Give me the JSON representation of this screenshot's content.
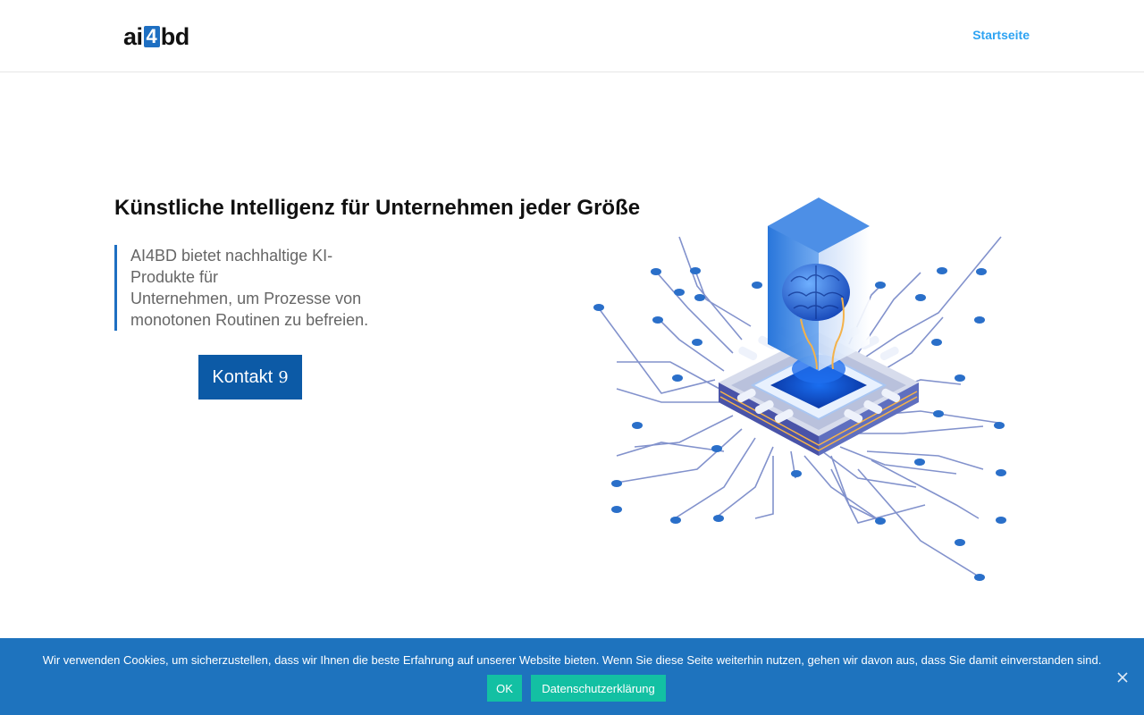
{
  "header": {
    "logo": {
      "part1": "ai",
      "part2": "4",
      "part3": "bd"
    },
    "nav": [
      {
        "label": "Startseite"
      }
    ]
  },
  "hero": {
    "title": "Künstliche Intelligenz für Unternehmen jeder Größe",
    "text_lines": [
      "AI4BD bietet nachhaltige KI-",
      "Produkte für",
      "Unternehmen, um Prozesse von",
      "monotonen Routinen zu befreien."
    ],
    "button": {
      "label": "Kontakt",
      "icon": "chat-icon",
      "icon_glyph": "9"
    }
  },
  "illustration": {
    "icon": "ai-chip-brain-illustration"
  },
  "cookie_bar": {
    "text": "Wir verwenden Cookies, um sicherzustellen, dass wir Ihnen die beste Erfahrung auf unserer Website bieten. Wenn Sie diese Seite weiterhin nutzen, gehen wir davon aus, dass Sie damit einverstanden sind.",
    "ok_label": "OK",
    "privacy_label": "Datenschutzerklärung",
    "close_icon": "close-icon"
  },
  "colors": {
    "accent": "#2ea3f2",
    "brand_blue": "#1e73be",
    "button_blue": "#0c5aa6",
    "cookie_button": "#13c0a3"
  }
}
